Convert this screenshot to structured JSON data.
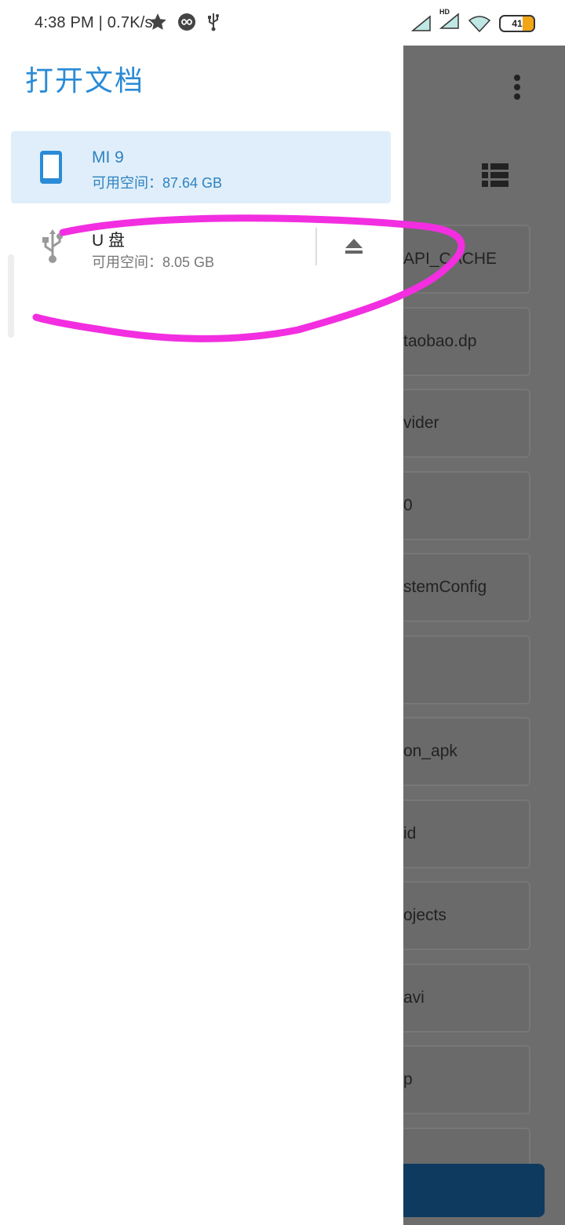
{
  "status_bar": {
    "time": "4:38 PM | 0.7K/s",
    "hd_label": "HD",
    "battery_level": "41",
    "icons": [
      "star-icon",
      "infinity-icon",
      "usb-icon",
      "signal-icon",
      "signal-hd-icon",
      "wifi-icon",
      "battery-icon"
    ]
  },
  "drawer": {
    "title": "打开文档",
    "roots": [
      {
        "title": "MI 9",
        "subtitle": "可用空间：87.64 GB",
        "icon": "phone-icon",
        "selected": true
      },
      {
        "title": "U 盘",
        "subtitle": "可用空间：8.05 GB",
        "icon": "usb-icon",
        "eject_icon": "eject-icon"
      }
    ]
  },
  "background_app": {
    "items": [
      "API_CACHE",
      "taobao.dp",
      "vider",
      "0",
      "stemConfig",
      "",
      "on_apk",
      "id",
      "ojects",
      "avi",
      "p"
    ],
    "icons": [
      "more-vert-icon",
      "list-view-icon"
    ]
  },
  "colors": {
    "accent": "#2a8bd6",
    "selected_bg": "#dfeefa",
    "annotation": "#f22ee0",
    "scrim": "#6d6d6d"
  }
}
